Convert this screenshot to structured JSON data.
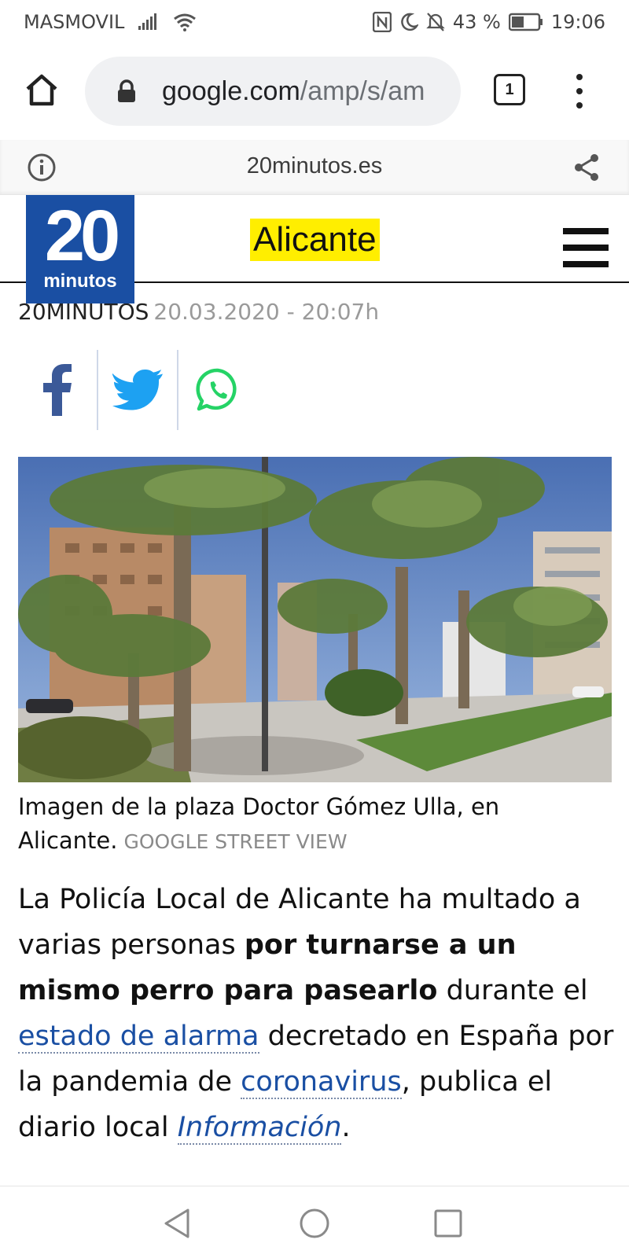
{
  "status_bar": {
    "carrier": "MASMOVIL",
    "battery": "43 %",
    "time": "19:06"
  },
  "browser": {
    "url_host": "google.com",
    "url_path": "/amp/s/am",
    "tab_count": "1"
  },
  "amp_header": {
    "domain": "20minutos.es"
  },
  "site": {
    "logo_number": "20",
    "logo_word": "minutos",
    "section": "Alicante",
    "accent": "#ffee00",
    "brand": "#1a4fa3"
  },
  "article": {
    "author": "20MINUTOS",
    "date": "20.03.2020 - 20:07h",
    "caption": "Imagen de la plaza Doctor Gómez Ulla, en Alicante.",
    "photo_credit": "GOOGLE STREET VIEW",
    "body": {
      "p1": "La Policía Local de Alicante ha multado a varias personas ",
      "bold": "por turnarse a un mismo perro para pasearlo",
      "p2": " durante el ",
      "link1": "estado de alarma",
      "p3": " decretado en España por la pandemia de ",
      "link2": "coronavirus",
      "p4": ", publica el diario local ",
      "link3": "Información",
      "p5": "."
    }
  },
  "social": {
    "icons": [
      "facebook-icon",
      "twitter-icon",
      "whatsapp-icon"
    ]
  }
}
